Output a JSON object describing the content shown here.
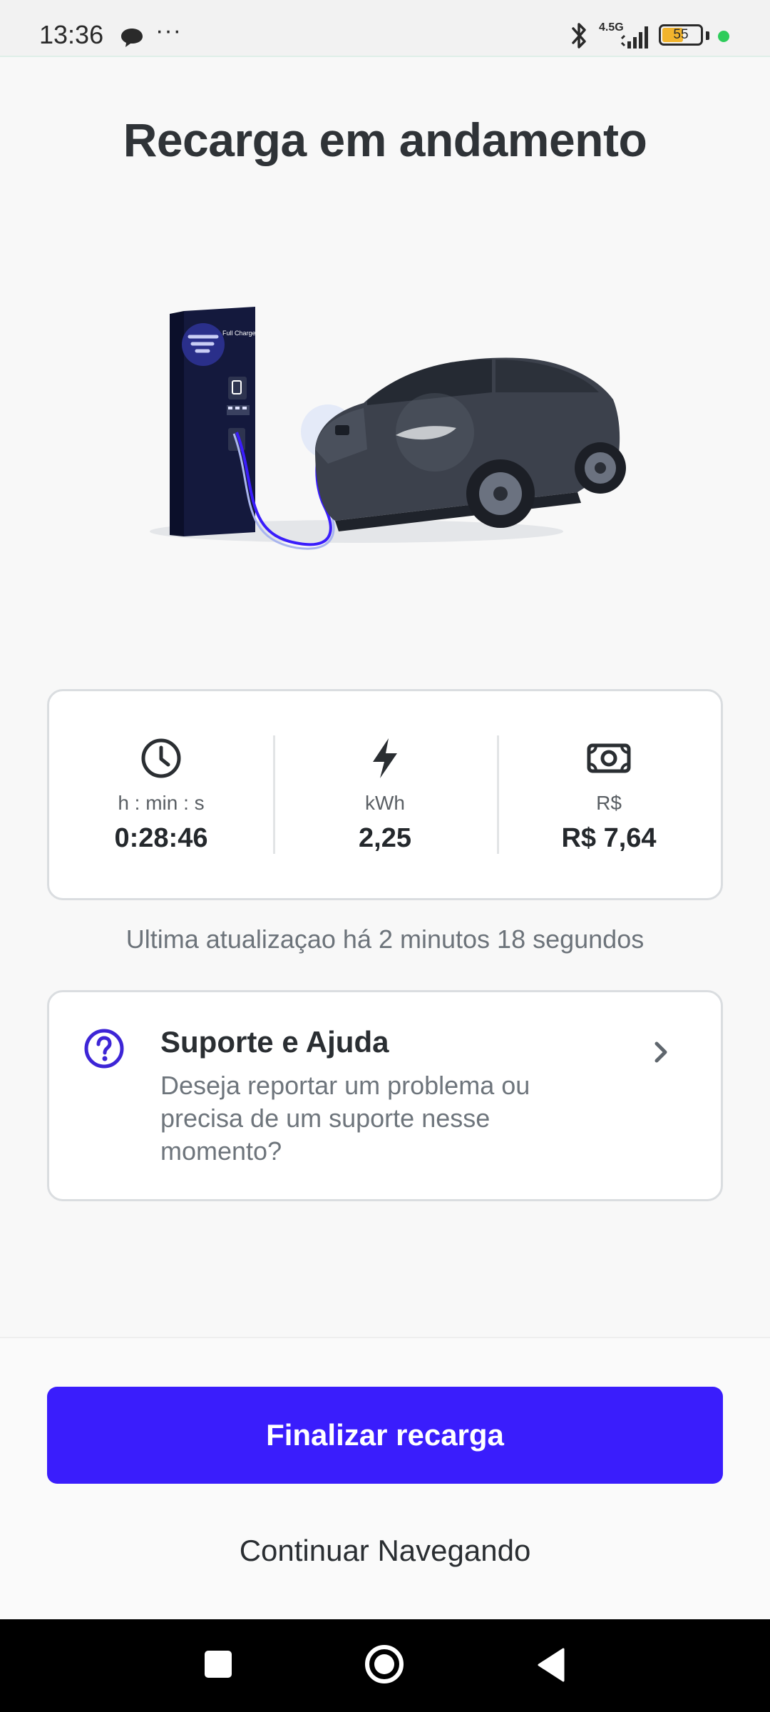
{
  "status_bar": {
    "time": "13:36",
    "network": "4.5G",
    "battery": "55",
    "icons": [
      "chat-bubble-icon",
      "more-dots-icon",
      "bluetooth-icon",
      "signal-icon",
      "battery-icon",
      "active-dot-icon"
    ],
    "battery_color": "#f2b42d",
    "dot_color": "#2ecc5b"
  },
  "header": {
    "title": "Recarga em andamento"
  },
  "illustration": {
    "station_brand": "Full Charge"
  },
  "stats": [
    {
      "icon": "clock-icon",
      "label": "h : min : s",
      "value": "0:28:46"
    },
    {
      "icon": "lightning-icon",
      "label": "kWh",
      "value": "2,25"
    },
    {
      "icon": "banknote-icon",
      "label": "R$",
      "value": "R$ 7,64"
    }
  ],
  "update_note": "Ultima atualizaçao há 2 minutos 18 segundos",
  "support": {
    "icon": "question-circle-icon",
    "title": "Suporte e Ajuda",
    "description": "Deseja reportar um problema ou precisa de um suporte nesse momento?",
    "chevron_icon": "chevron-right-icon"
  },
  "actions": {
    "finish_label": "Finalizar recarga",
    "continue_label": "Continuar Navegando"
  },
  "nav": {
    "icons": [
      "recent-apps-icon",
      "home-icon",
      "back-icon"
    ]
  },
  "colors": {
    "primary": "#3a1dfc",
    "icon_purple": "#3d25d6",
    "text_dark": "#2b2f33",
    "text_muted": "#6c737a"
  }
}
